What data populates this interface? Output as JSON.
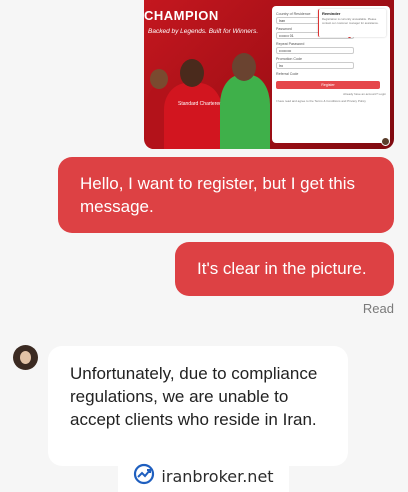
{
  "attachment": {
    "banner": "CHAMPION",
    "subtitle": "Backed by Legends. Built for Winners.",
    "player_text": "Standard Chartered",
    "form": {
      "country_label": "Country of Residence",
      "country_value": "Iran",
      "password_label": "Password",
      "password_value": "•••••••• 01",
      "repeat_label": "Repeat Password",
      "repeat_value": "••••••••••",
      "promo_label": "Promotion Code",
      "promo_value": "Iro",
      "referral_label": "Referral Code",
      "register_label": "Register",
      "have_account": "Already have an account? Login",
      "terms": "I have read and agree to the Terms & Conditions and Privacy Policy"
    },
    "reminder": {
      "title": "Reminder",
      "text": "Registration is currently unavailable. Please contact our customer manager for assistance."
    }
  },
  "messages": {
    "outgoing_1": "Hello, I want to register, but I get this message.",
    "outgoing_2": "It's clear in the picture.",
    "read_status": "Read",
    "incoming_1": "Unfortunately, due to compliance regulations, we are unable to accept clients who reside in Iran."
  },
  "watermark": {
    "text": "iranbroker.net",
    "logo_icon": "chart-arrow-icon"
  },
  "colors": {
    "outgoing_bubble": "#dd4144",
    "incoming_bubble": "#ffffff",
    "background": "#f6f6f6"
  }
}
